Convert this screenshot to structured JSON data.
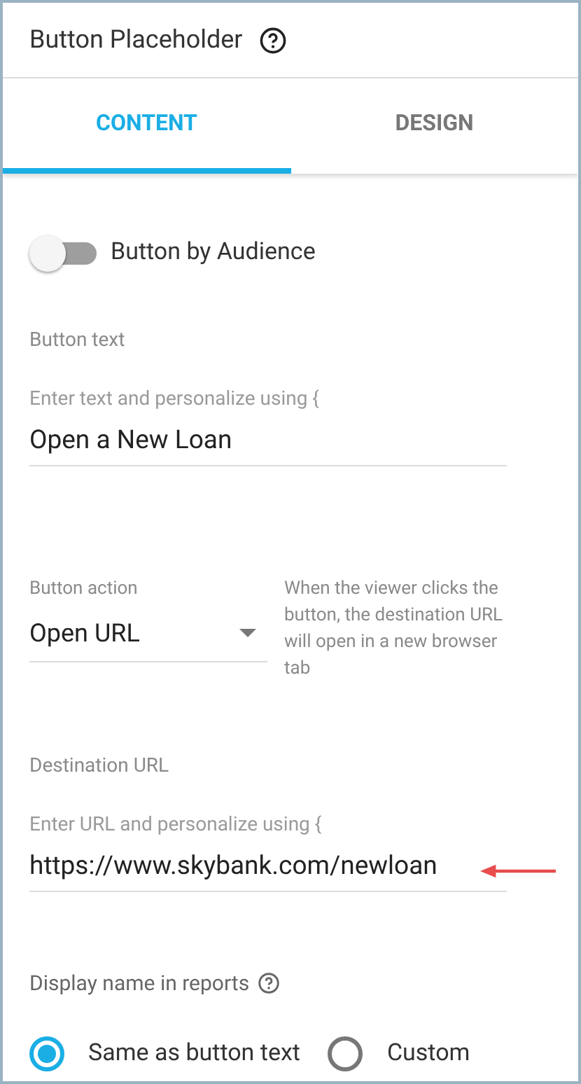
{
  "header": {
    "title": "Button Placeholder"
  },
  "tabs": [
    {
      "label": "CONTENT",
      "selected": true
    },
    {
      "label": "DESIGN",
      "selected": false
    }
  ],
  "audience_toggle": {
    "label": "Button by Audience",
    "on": false
  },
  "button_text": {
    "label": "Button text",
    "placeholder": "Enter text and personalize using {",
    "value": "Open a New Loan"
  },
  "button_action": {
    "label": "Button action",
    "value": "Open URL",
    "help": "When the viewer clicks the button, the destination URL will open in a new browser tab"
  },
  "destination_url": {
    "label": "Destination URL",
    "placeholder": "Enter URL and personalize using {",
    "value": "https://www.skybank.com/newloan"
  },
  "display_name": {
    "label": "Display name in reports",
    "options": [
      {
        "label": "Same as button text",
        "selected": true
      },
      {
        "label": "Custom",
        "selected": false
      }
    ]
  }
}
